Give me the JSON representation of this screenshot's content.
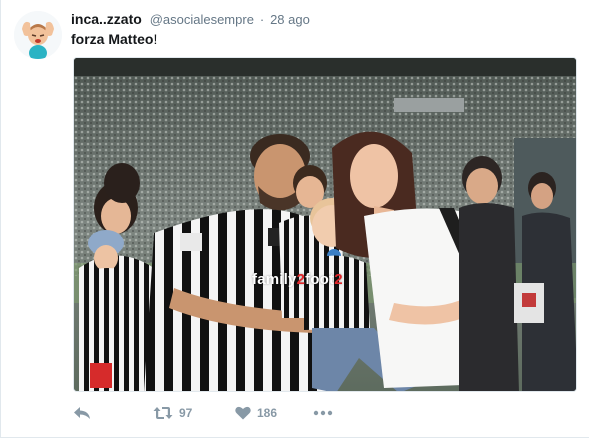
{
  "tweet": {
    "author": {
      "display_name": "inca..zzato",
      "username": "@asocialesempre",
      "separator": "·",
      "time": "28 ago"
    },
    "text": {
      "main": "forza Matteo",
      "suffix": "!"
    },
    "media": {
      "watermark_part1": "family",
      "watermark_part2": "2",
      "watermark_part3": "foot",
      "watermark_part4": "2"
    },
    "actions": {
      "reply_icon": "reply-icon",
      "retweet_icon": "retweet-icon",
      "retweet_count": "97",
      "like_icon": "heart-icon",
      "like_count": "186",
      "more_icon": "more-icon"
    },
    "colors": {
      "icon": "#8899a6",
      "text_secondary": "#657786",
      "watermark_accent": "#e0262a"
    }
  }
}
